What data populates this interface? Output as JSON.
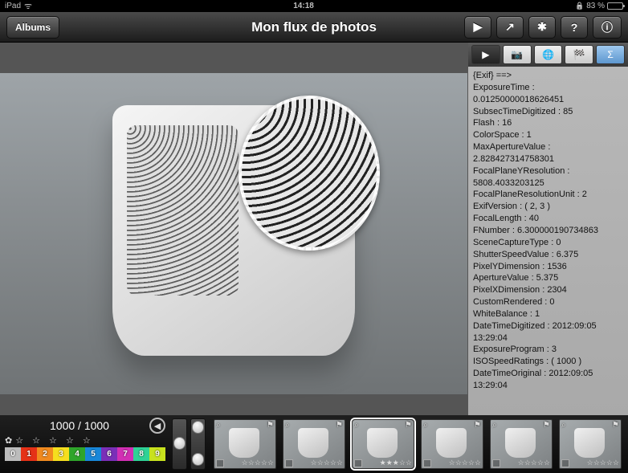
{
  "status": {
    "device": "iPad",
    "time": "14:18",
    "battery_pct": "83 %"
  },
  "toolbar": {
    "back_label": "Albums",
    "title": "Mon flux de photos",
    "play": "▶",
    "share": "↗",
    "settings": "✱",
    "help": "?",
    "info": "ⓘ"
  },
  "side": {
    "tabs": {
      "play": "▶",
      "camera": "📷",
      "globe": "🌐",
      "flag": "🏁",
      "sigma": "Σ"
    },
    "exif_text": "{Exif} ==>\nExposureTime : 0.01250000018626451\nSubsecTimeDigitized : 85\nFlash : 16\nColorSpace : 1\nMaxApertureValue : 2.828427314758301\nFocalPlaneYResolution : 5808.4033203125\nFocalPlaneResolutionUnit : 2\nExifVersion : ( 2, 3 )\nFocalLength : 40\nFNumber : 6.300000190734863\nSceneCaptureType : 0\nShutterSpeedValue : 6.375\nPixelYDimension : 1536\nApertureValue : 5.375\nPixelXDimension : 2304\nCustomRendered : 0\nWhiteBalance : 1\nDateTimeDigitized : 2012:09:05 13:29:04\nExposureProgram : 3\nISOSpeedRatings : ( 1000 )\nDateTimeOriginal : 2012:09:05 13:29:04"
  },
  "strip": {
    "counter": "1000 / 1000",
    "prev": "◀",
    "stars": "☆ ☆ ☆ ☆ ☆",
    "gear": "✿",
    "palette": [
      {
        "n": "0",
        "c": "#bcbcbc"
      },
      {
        "n": "1",
        "c": "#e53117"
      },
      {
        "n": "2",
        "c": "#f08a1f"
      },
      {
        "n": "3",
        "c": "#f5de1e"
      },
      {
        "n": "4",
        "c": "#2fa52b"
      },
      {
        "n": "5",
        "c": "#1887d9"
      },
      {
        "n": "6",
        "c": "#7a2fb8"
      },
      {
        "n": "7",
        "c": "#d22fb4"
      },
      {
        "n": "8",
        "c": "#2fd296"
      },
      {
        "n": "9",
        "c": "#c8e21e"
      }
    ],
    "thumbs": [
      {
        "stars": "☆☆☆☆☆",
        "sel": false
      },
      {
        "stars": "☆☆☆☆☆",
        "sel": false
      },
      {
        "stars": "★★★☆☆",
        "sel": true
      },
      {
        "stars": "☆☆☆☆☆",
        "sel": false
      },
      {
        "stars": "☆☆☆☆☆",
        "sel": false
      },
      {
        "stars": "☆☆☆☆☆",
        "sel": false
      }
    ],
    "flag_glyph": "⚑",
    "loupe_glyph": "⌕"
  }
}
